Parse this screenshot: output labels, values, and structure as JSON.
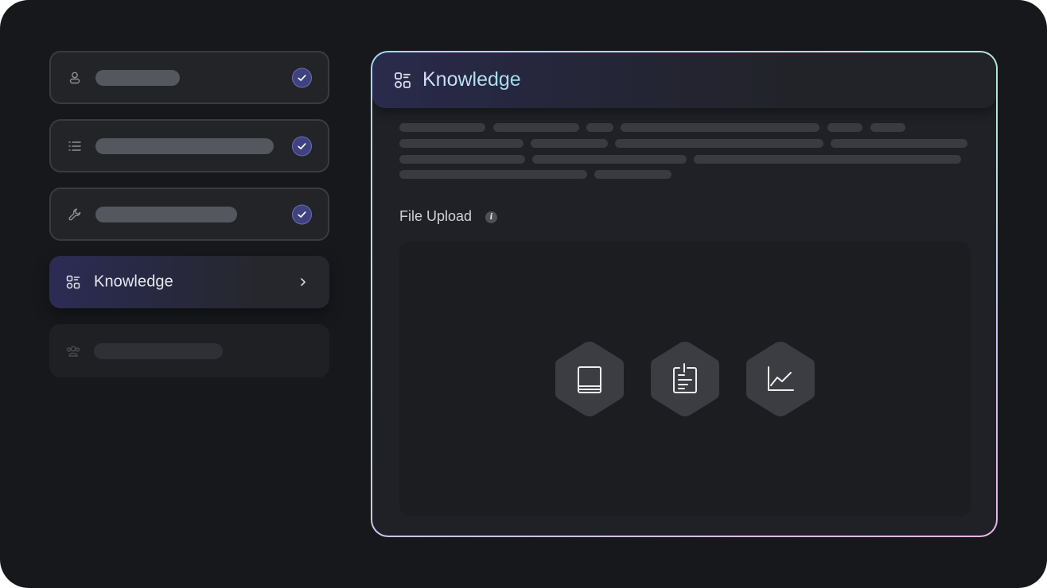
{
  "steps": [
    {
      "icon": "user-icon",
      "state": "completed"
    },
    {
      "icon": "list-icon",
      "state": "completed"
    },
    {
      "icon": "wrench-icon",
      "state": "completed"
    },
    {
      "icon": "knowledge-icon",
      "state": "active",
      "label": "Knowledge"
    },
    {
      "icon": "users-icon",
      "state": "disabled"
    }
  ],
  "panel": {
    "title": "Knowledge",
    "title_icon": "knowledge-icon",
    "upload_label": "File Upload",
    "info_icon": "i"
  },
  "upload_types": [
    "book-icon",
    "clipboard-document-icon",
    "line-chart-icon"
  ],
  "colors": {
    "background": "#17181c",
    "check": "#3f4280",
    "accent_gradient": [
      "#9fd9ef",
      "#c6c4ee",
      "#e9b4e6"
    ]
  }
}
